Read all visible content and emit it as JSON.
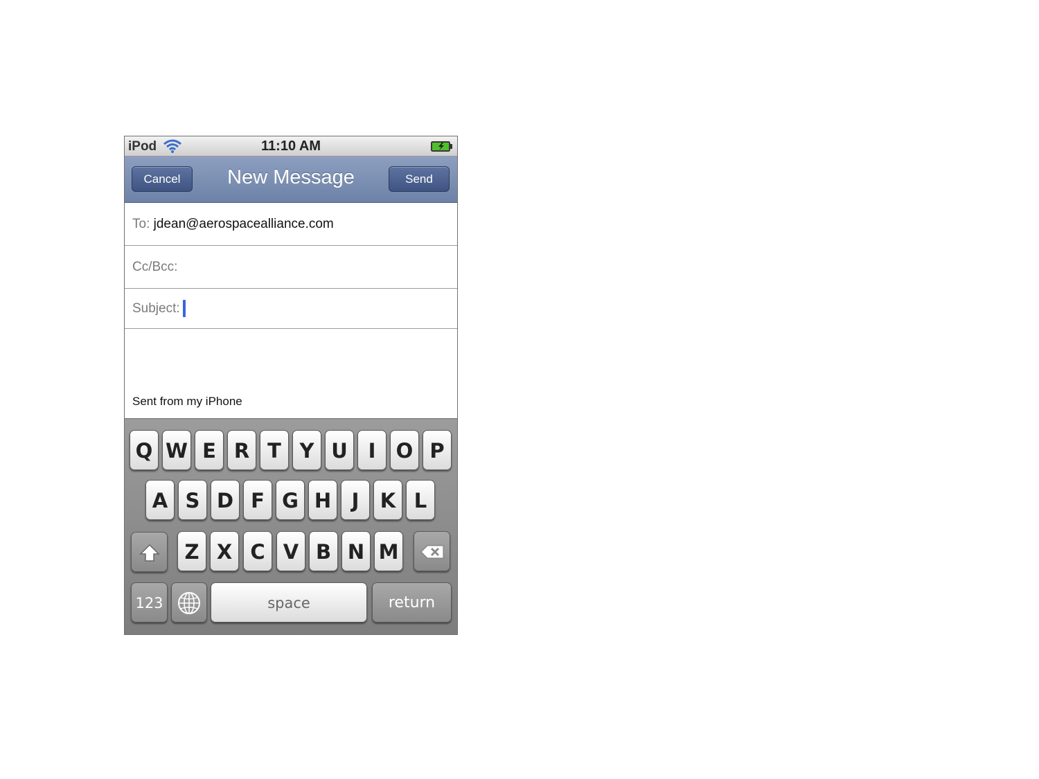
{
  "status_bar": {
    "carrier": "iPod",
    "time": "11:10 AM",
    "wifi_icon": "wifi-icon",
    "battery_icon": "battery-charging-icon"
  },
  "nav": {
    "cancel_label": "Cancel",
    "title": "New Message",
    "send_label": "Send"
  },
  "fields": {
    "to_label": "To:",
    "to_value": "jdean@aerospacealliance.com",
    "cc_label": "Cc/Bcc:",
    "subject_label": "Subject:"
  },
  "body": {
    "signature": "Sent from my iPhone"
  },
  "keyboard": {
    "row1": [
      "Q",
      "W",
      "E",
      "R",
      "T",
      "Y",
      "U",
      "I",
      "O",
      "P"
    ],
    "row2": [
      "A",
      "S",
      "D",
      "F",
      "G",
      "H",
      "J",
      "K",
      "L"
    ],
    "row3": [
      "Z",
      "X",
      "C",
      "V",
      "B",
      "N",
      "M"
    ],
    "numbers_label": "123",
    "space_label": "space",
    "return_label": "return",
    "shift_icon": "shift-icon",
    "globe_icon": "globe-icon",
    "delete_icon": "delete-icon"
  },
  "colors": {
    "navbar": "#7688ad",
    "cursor": "#3c63e0"
  }
}
